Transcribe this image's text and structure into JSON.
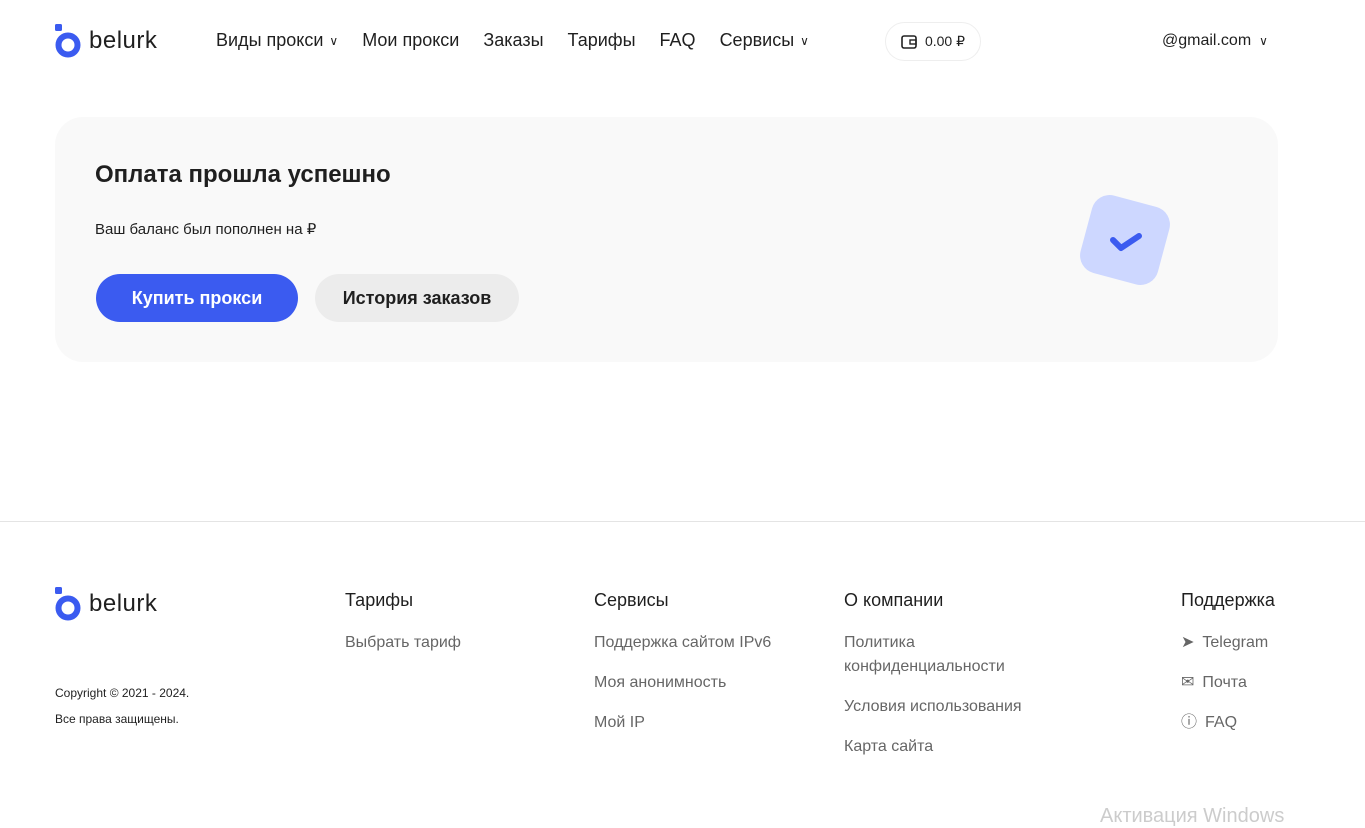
{
  "brand": "belurk",
  "nav": [
    "Виды прокси",
    "Мои прокси",
    "Заказы",
    "Тарифы",
    "FAQ",
    "Сервисы"
  ],
  "wallet": "0.00 ₽",
  "user": "@gmail.com",
  "card": {
    "title": "Оплата прошла успешно",
    "text": "Ваш баланс был пополнен на ₽",
    "buy": "Купить прокси",
    "history": "История заказов"
  },
  "footer": {
    "copyright": "Copyright © 2021 - 2024.",
    "rights": "Все права защищены.",
    "tariffs": {
      "title": "Тарифы",
      "links": [
        "Выбрать тариф"
      ]
    },
    "services": {
      "title": "Сервисы",
      "links": [
        "Поддержка сайтом IPv6",
        "Моя анонимность",
        "Мой IP"
      ]
    },
    "company": {
      "title": "О компании",
      "links": [
        "Политика конфиденциальности",
        "Условия использования",
        "Карта сайта"
      ]
    },
    "support": {
      "title": "Поддержка",
      "links": [
        "Telegram",
        "Почта",
        "FAQ"
      ]
    }
  },
  "watermark": "Активация Windows",
  "colors": {
    "accent": "#3b5bf0"
  }
}
